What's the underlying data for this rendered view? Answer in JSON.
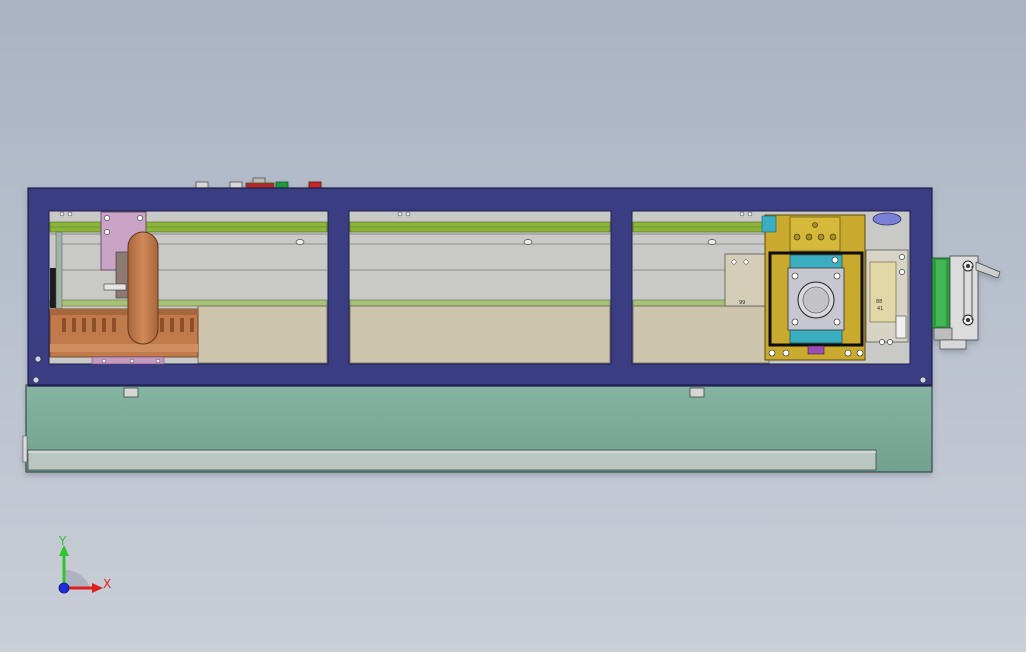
{
  "scene": {
    "background_top": "#a9b3c3",
    "background_bottom": "#c9ced7"
  },
  "colors": {
    "frame": "#3b3e82",
    "frame_edge": "#1d1f4a",
    "base": "#7fae9c",
    "rail_green": "#8ab43a",
    "panel_gray": "#c7c8c4",
    "panel_tan": "#cdc5ad",
    "copper": "#c07a4c",
    "lilac": "#c9a4c7",
    "gold": "#c9aa2d",
    "cyan": "#3aaec0",
    "accent_blue": "#7b7fd6"
  },
  "triad": {
    "y_label": "Y",
    "x_label": "X",
    "y_color": "#2ec52e",
    "x_color": "#e02020",
    "z_color": "#1f2bd6"
  },
  "labels": {
    "bracket_mark": "99",
    "module_mark_1": "88",
    "module_mark_2": "41"
  }
}
